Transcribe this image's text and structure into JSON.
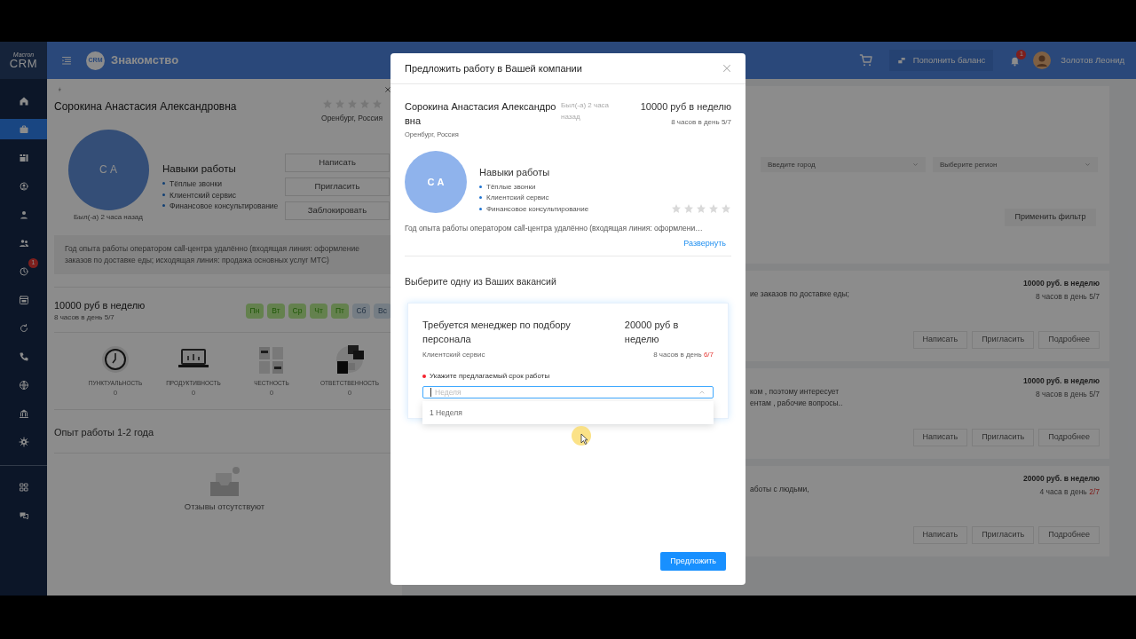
{
  "sidebar": {
    "logo_top": "Macron",
    "logo_bottom": "CRM",
    "items": [
      {
        "kind": "home",
        "selected": false
      },
      {
        "kind": "briefcase",
        "selected": true
      },
      {
        "kind": "grid",
        "selected": false
      },
      {
        "kind": "person-circle",
        "selected": false
      },
      {
        "kind": "user",
        "selected": false
      },
      {
        "kind": "users",
        "selected": false
      },
      {
        "kind": "clock",
        "selected": false,
        "badge": "1"
      },
      {
        "kind": "calendar",
        "selected": false
      },
      {
        "kind": "refresh",
        "selected": false
      },
      {
        "kind": "phone",
        "selected": false
      },
      {
        "kind": "globe",
        "selected": false
      },
      {
        "kind": "bank",
        "selected": false
      },
      {
        "kind": "settings",
        "selected": false
      },
      {
        "kind": "apps",
        "selected": false
      },
      {
        "kind": "chat",
        "selected": false
      }
    ]
  },
  "header": {
    "logo": "CRM",
    "title": "Знакомство",
    "balance_button": "Пополнить баланс",
    "notifications_badge": "1",
    "user_name": "Золотов Леонид"
  },
  "profile": {
    "name": "Сорокина Анастасия Александровна",
    "stars": 0,
    "location": "Оренбург, Россия",
    "initials": "С А",
    "seen": "Был(-а) 2 часа назад",
    "skills_title": "Навыки работы",
    "skills": [
      "Тёплые звонки",
      "Клиентский сервис",
      "Финансовое консультирование"
    ],
    "buttons": [
      "Написать",
      "Пригласить",
      "Заблокировать"
    ],
    "description": "Год опыта работы оператором call-центра удалённо (входящая линия: оформление заказов по доставке еды; исходящая линия: продажа основных услуг МТС)",
    "price": "10000 руб в неделю",
    "hours": "8 часов в день 5/7",
    "days": [
      {
        "label": "Пн",
        "on": true
      },
      {
        "label": "Вт",
        "on": true
      },
      {
        "label": "Ср",
        "on": true
      },
      {
        "label": "Чт",
        "on": true
      },
      {
        "label": "Пт",
        "on": true
      },
      {
        "label": "Сб",
        "on": false
      },
      {
        "label": "Вс",
        "on": false
      }
    ],
    "qualities": [
      {
        "kind": "clock",
        "label": "ПУНКТУАЛЬНОСТЬ",
        "value": "0"
      },
      {
        "kind": "laptop",
        "label": "ПРОДУКТИВНОСТЬ",
        "value": "0"
      },
      {
        "kind": "documents",
        "label": "ЧЕСТНОСТЬ",
        "value": "0"
      },
      {
        "kind": "papers",
        "label": "ОТВЕТСТВЕННОСТЬ",
        "value": "0"
      }
    ],
    "experience": "Опыт работы 1-2 года",
    "reviews_empty": "Отзывы отсутствуют"
  },
  "filter": {
    "city_placeholder": "Введите город",
    "region_placeholder": "Выберите регион",
    "apply_button": "Применить фильтр"
  },
  "candidates": [
    {
      "lines": [
        "ие заказов по доставке еды;"
      ],
      "price": "10000 руб. в неделю",
      "hours": "8 часов в день",
      "days": "5/7",
      "days_warning": false,
      "buttons": [
        "Написать",
        "Пригласить",
        "Подробнее"
      ]
    },
    {
      "lines": [
        "ком , поэтому интересует",
        "ентам , рабочие вопросы.."
      ],
      "price": "10000 руб. в неделю",
      "hours": "8 часов в день",
      "days": "5/7",
      "days_warning": false,
      "buttons": [
        "Написать",
        "Пригласить",
        "Подробнее"
      ]
    },
    {
      "lines": [
        "аботы с людьми,"
      ],
      "price": "20000 руб. в неделю",
      "hours": "4 часа в день",
      "days": "2/7",
      "days_warning": true,
      "buttons": [
        "Написать",
        "Пригласить",
        "Подробнее"
      ]
    }
  ],
  "modal": {
    "title": "Предложить работу в Вашей компании",
    "candidate": {
      "name": "Сорокина Анастасия Александровна",
      "seen": "Был(-а) 2 часа назад",
      "location": "Оренбург, Россия",
      "price": "10000 руб в неделю",
      "hours": "8 часов в день",
      "days": "5/7",
      "days_warning": false,
      "initials": "С А",
      "skills_title": "Навыки работы",
      "skills": [
        "Тёплые звонки",
        "Клиентский сервис",
        "Финансовое консультирование"
      ],
      "stars": 0,
      "description": "Год опыта работы оператором call-центра удалённо (входящая линия: оформлени…",
      "expand_link": "Развернуть"
    },
    "vacancies_heading": "Выберите одну из Ваших вакансий",
    "vacancy": {
      "title": "Требуется менеджер по подбору персонала",
      "price": "20000 руб в неделю",
      "category": "Клиентский сервис",
      "hours": "8 часов в день",
      "days": "6/7",
      "days_warning": true,
      "term_label": "Укажите предлагаемый срок работы",
      "required": true,
      "term_placeholder": "Неделя",
      "expanded": true,
      "options": [
        "1 Неделя"
      ]
    },
    "submit_button": "Предложить"
  }
}
